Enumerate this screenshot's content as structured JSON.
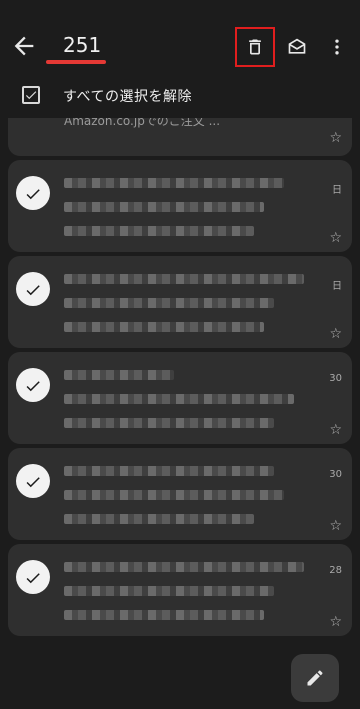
{
  "header": {
    "selected_count": "251",
    "back_icon": "arrow-back-icon",
    "delete_icon": "trash-icon",
    "mark_read_icon": "mail-open-icon",
    "more_icon": "more-vert-icon"
  },
  "selection": {
    "label": "すべての選択を解除"
  },
  "emails": [
    {
      "preview": "Amazon.co.jpでのご注文 ...",
      "date": "",
      "partial": true
    },
    {
      "date": "日",
      "partial": false
    },
    {
      "date": "日",
      "partial": false
    },
    {
      "date": "30",
      "partial": false
    },
    {
      "date": "30",
      "partial": false
    },
    {
      "date": "28",
      "partial": false
    }
  ],
  "fab": {
    "icon": "pencil-icon"
  },
  "colors": {
    "background": "#1c1c1c",
    "card": "#2f2f2f",
    "highlight": "#e01e1e"
  }
}
